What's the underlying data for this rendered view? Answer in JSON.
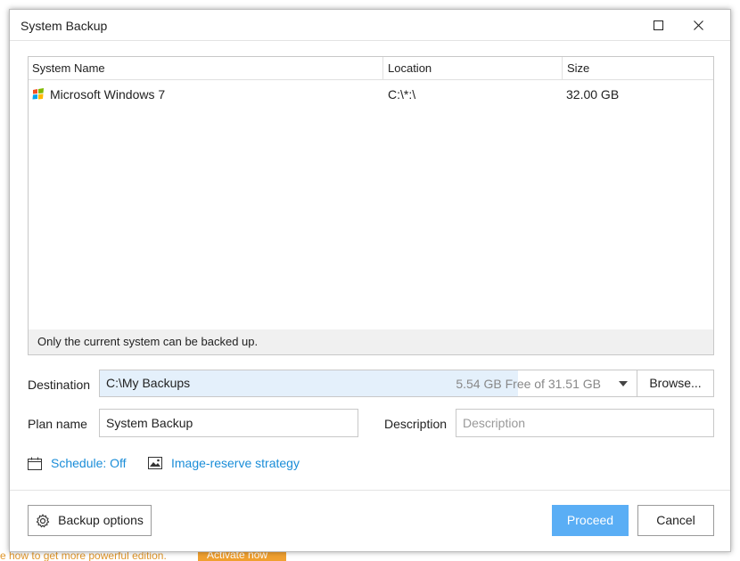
{
  "background": {
    "hint_text": "e how to get more powerful edition.",
    "activate_label": "Activate now"
  },
  "window": {
    "title": "System Backup"
  },
  "table": {
    "columns": [
      "System Name",
      "Location",
      "Size"
    ],
    "rows": [
      {
        "name": "Microsoft Windows 7",
        "location": "C:\\*:\\",
        "size": "32.00 GB",
        "icon": "windows-logo-icon"
      }
    ],
    "note": "Only the current system can be backed up."
  },
  "destination": {
    "label": "Destination",
    "path": "C:\\My Backups",
    "free_text": "5.54 GB Free of 31.51 GB",
    "used_fraction": 0.82,
    "browse_label": "Browse..."
  },
  "plan": {
    "label": "Plan name",
    "value": "System Backup",
    "description_label": "Description",
    "description_placeholder": "Description"
  },
  "links": {
    "schedule": "Schedule: Off",
    "strategy": "Image-reserve strategy"
  },
  "buttons": {
    "backup_options": "Backup options",
    "proceed": "Proceed",
    "cancel": "Cancel"
  },
  "colors": {
    "accent": "#5aaef5",
    "link": "#1a8dd8"
  }
}
